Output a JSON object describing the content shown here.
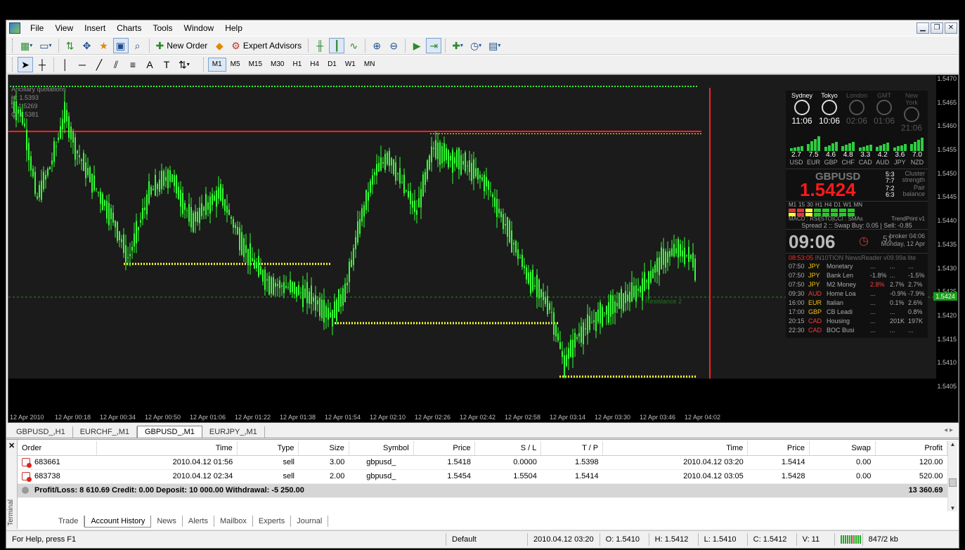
{
  "menu": [
    "File",
    "View",
    "Insert",
    "Charts",
    "Tools",
    "Window",
    "Help"
  ],
  "toolbar": {
    "new_order": "New Order",
    "expert_advisors": "Expert Advisors",
    "timeframes": [
      "M1",
      "M5",
      "M15",
      "M30",
      "H1",
      "H4",
      "D1",
      "W1",
      "MN"
    ],
    "active_timeframe": "M1"
  },
  "chart": {
    "ohlc_header": "Ancillary quotations",
    "h": "H: 1.5393",
    "l": "L: 1.5269",
    "c": "C: 1.5381",
    "resistance_label": "Resistance 2",
    "current_price": "1.5424",
    "price_ticks": [
      "1.5470",
      "1.5465",
      "1.5460",
      "1.5455",
      "1.5450",
      "1.5445",
      "1.5440",
      "1.5435",
      "1.5430",
      "1.5425",
      "1.5420",
      "1.5415",
      "1.5410",
      "1.5405"
    ],
    "time_ticks": [
      "12 Apr 2010",
      "12 Apr 00:18",
      "12 Apr 00:34",
      "12 Apr 00:50",
      "12 Apr 01:06",
      "12 Apr 01:22",
      "12 Apr 01:38",
      "12 Apr 01:54",
      "12 Apr 02:10",
      "12 Apr 02:26",
      "12 Apr 02:42",
      "12 Apr 02:58",
      "12 Apr 03:14",
      "12 Apr 03:30",
      "12 Apr 03:46",
      "12 Apr 04:02"
    ],
    "colors": {
      "candle": "#33ff33",
      "resistance": "#ff2222",
      "support": "#ffff33",
      "accent_line": "#33ff33"
    }
  },
  "panel": {
    "clocks": [
      {
        "name": "Sydney",
        "time": "11:06",
        "active": true
      },
      {
        "name": "Tokyo",
        "time": "10:06",
        "active": true
      },
      {
        "name": "London",
        "time": "02:06",
        "active": false
      },
      {
        "name": "GMT",
        "time": "01:06",
        "active": false
      },
      {
        "name": "New York",
        "time": "21:06",
        "active": false
      }
    ],
    "strength": [
      {
        "cur": "USD",
        "val": "2.7"
      },
      {
        "cur": "EUR",
        "val": "7.5"
      },
      {
        "cur": "GBP",
        "val": "4.6"
      },
      {
        "cur": "CHF",
        "val": "4.8"
      },
      {
        "cur": "CAD",
        "val": "3.3"
      },
      {
        "cur": "AUD",
        "val": "4.2"
      },
      {
        "cur": "JPY",
        "val": "3.6"
      },
      {
        "cur": "NZD",
        "val": "7.0"
      }
    ],
    "pair": "GBPUSD",
    "price": "1.5424",
    "cluster_label": "Cluster strength",
    "pair_balance_label": "Pair balance",
    "ratios": [
      "5:3",
      "7:7",
      "7:2",
      "6:3"
    ],
    "tf_labels": [
      "M1",
      "15",
      "30",
      "H1",
      "H4",
      "D1",
      "W1",
      "MN"
    ],
    "indicators": "MACD : RSI|STO|CCI : SMAs",
    "trendprint": "TrendPrint v1",
    "spread": "Spread 2 :: Swap Buy: 0.05 | Sell: -0.85",
    "time": "09:06",
    "seconds": "51",
    "broker": "broker 04:06",
    "date": "Monday, 12 Apr",
    "news_time": "08:53:05",
    "news_title": "IN10TION NewsReader v09.99a lite",
    "news": [
      {
        "time": "07:50",
        "cur": "JPY",
        "event": "Monetary",
        "a": "...",
        "f": "...",
        "p": "..."
      },
      {
        "time": "07:50",
        "cur": "JPY",
        "event": "Bank Len",
        "a": "-1.8%",
        "f": "...",
        "p": "-1.5%"
      },
      {
        "time": "07:50",
        "cur": "JPY",
        "event": "M2 Money",
        "a": "2.8%",
        "f": "2.7%",
        "p": "2.7%"
      },
      {
        "time": "09:30",
        "cur": "AUD",
        "event": "Home Loa",
        "a": "...",
        "f": "-0.9%",
        "p": "-7.9%"
      },
      {
        "time": "16:00",
        "cur": "EUR",
        "event": "Italian",
        "a": "...",
        "f": "0.1%",
        "p": "2.6%"
      },
      {
        "time": "17:00",
        "cur": "GBP",
        "event": "CB Leadi",
        "a": "...",
        "f": "...",
        "p": "0.8%"
      },
      {
        "time": "20:15",
        "cur": "CAD",
        "event": "Housing",
        "a": "...",
        "f": "201K",
        "p": "197K"
      },
      {
        "time": "22:30",
        "cur": "CAD",
        "event": "BOC Busi",
        "a": "...",
        "f": "...",
        "p": "..."
      }
    ]
  },
  "chart_tabs": [
    "GBPUSD_,H1",
    "EURCHF_,M1",
    "GBPUSD_,M1",
    "EURJPY_,M1"
  ],
  "active_chart_tab": "GBPUSD_,M1",
  "orders": {
    "headers": [
      "Order",
      "Time",
      "Type",
      "Size",
      "Symbol",
      "Price",
      "S / L",
      "T / P",
      "Time",
      "Price",
      "Swap",
      "Profit"
    ],
    "rows": [
      [
        "683661",
        "2010.04.12 01:56",
        "sell",
        "3.00",
        "gbpusd_",
        "1.5418",
        "0.0000",
        "1.5398",
        "2010.04.12 03:20",
        "1.5414",
        "0.00",
        "120.00"
      ],
      [
        "683738",
        "2010.04.12 02:34",
        "sell",
        "2.00",
        "gbpusd_",
        "1.5454",
        "1.5504",
        "1.5414",
        "2010.04.12 03:05",
        "1.5428",
        "0.00",
        "520.00"
      ]
    ],
    "summary": "Profit/Loss: 8 610.69  Credit: 0.00  Deposit: 10 000.00  Withdrawal: -5 250.00",
    "total": "13 360.69"
  },
  "terminal_label": "Terminal",
  "terminal_tabs": [
    "Trade",
    "Account History",
    "News",
    "Alerts",
    "Mailbox",
    "Experts",
    "Journal"
  ],
  "active_terminal_tab": "Account History",
  "status": {
    "help": "For Help, press F1",
    "profile": "Default",
    "datetime": "2010.04.12 03:20",
    "o": "O: 1.5410",
    "h": "H: 1.5412",
    "l": "L: 1.5410",
    "c": "C: 1.5412",
    "v": "V: 11",
    "traffic": "847/2 kb"
  }
}
